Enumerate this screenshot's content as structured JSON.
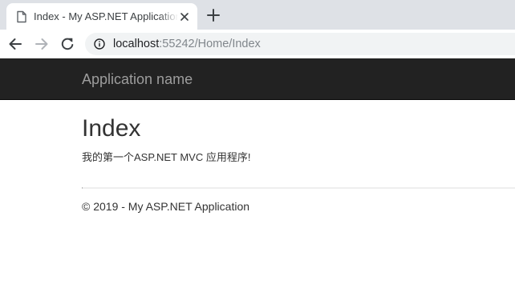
{
  "browser": {
    "tab": {
      "title": "Index - My ASP.NET Application",
      "favicon_icon": "document-icon",
      "close_icon": "close-icon"
    },
    "new_tab_icon": "plus-icon",
    "nav": {
      "back_icon": "arrow-left-icon",
      "forward_icon": "arrow-right-icon",
      "reload_icon": "reload-icon"
    },
    "address": {
      "info_icon": "info-icon",
      "host": "localhost",
      "rest": ":55242/Home/Index"
    }
  },
  "navbar": {
    "brand": "Application name",
    "background_color": "#222222",
    "brand_color": "#9d9d9d"
  },
  "main": {
    "title": "Index",
    "text": "我的第一个ASP.NET MVC 应用程序!"
  },
  "footer": {
    "text": "© 2019 - My ASP.NET Application"
  }
}
